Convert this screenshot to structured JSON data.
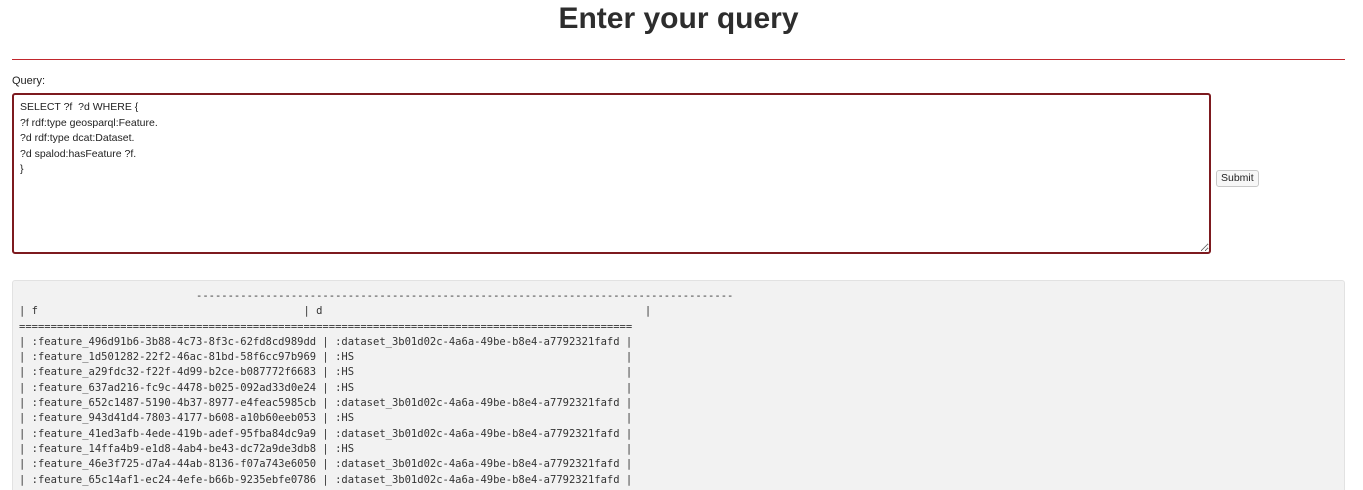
{
  "header": {
    "title": "Enter your query"
  },
  "query_form": {
    "label": "Query:",
    "query_text": "SELECT ?f  ?d WHERE {\n?f rdf:type geosparql:Feature.\n?d rdf:type dcat:Dataset.\n?d spalod:hasFeature ?f.\n}",
    "submit_label": "Submit"
  },
  "results": {
    "lines": [
      "                            -------------------------------------------------------------------------------------",
      "| f                                          | d                                                   |",
      "=================================================================================================",
      "| :feature_496d91b6-3b88-4c73-8f3c-62fd8cd989dd | :dataset_3b01d02c-4a6a-49be-b8e4-a7792321fafd |",
      "| :feature_1d501282-22f2-46ac-81bd-58f6cc97b969 | :HS                                           |",
      "| :feature_a29fdc32-f22f-4d99-b2ce-b087772f6683 | :HS                                           |",
      "| :feature_637ad216-fc9c-4478-b025-092ad33d0e24 | :HS                                           |",
      "| :feature_652c1487-5190-4b37-8977-e4feac5985cb | :dataset_3b01d02c-4a6a-49be-b8e4-a7792321fafd |",
      "| :feature_943d41d4-7803-4177-b608-a10b60eeb053 | :HS                                           |",
      "| :feature_41ed3afb-4ede-419b-adef-95fba84dc9a9 | :dataset_3b01d02c-4a6a-49be-b8e4-a7792321fafd |",
      "| :feature_14ffa4b9-e1d8-4ab4-be43-dc72a9de3db8 | :HS                                           |",
      "| :feature_46e3f725-d7a4-44ab-8136-f07a743e6050 | :dataset_3b01d02c-4a6a-49be-b8e4-a7792321fafd |",
      "| :feature_65c14af1-ec24-4efe-b66b-9235ebfe0786 | :dataset_3b01d02c-4a6a-49be-b8e4-a7792321fafd |"
    ]
  },
  "colors": {
    "accent_rule": "#c1272d",
    "textarea_border": "#7d1a1f",
    "results_background": "#f2f2f2"
  }
}
